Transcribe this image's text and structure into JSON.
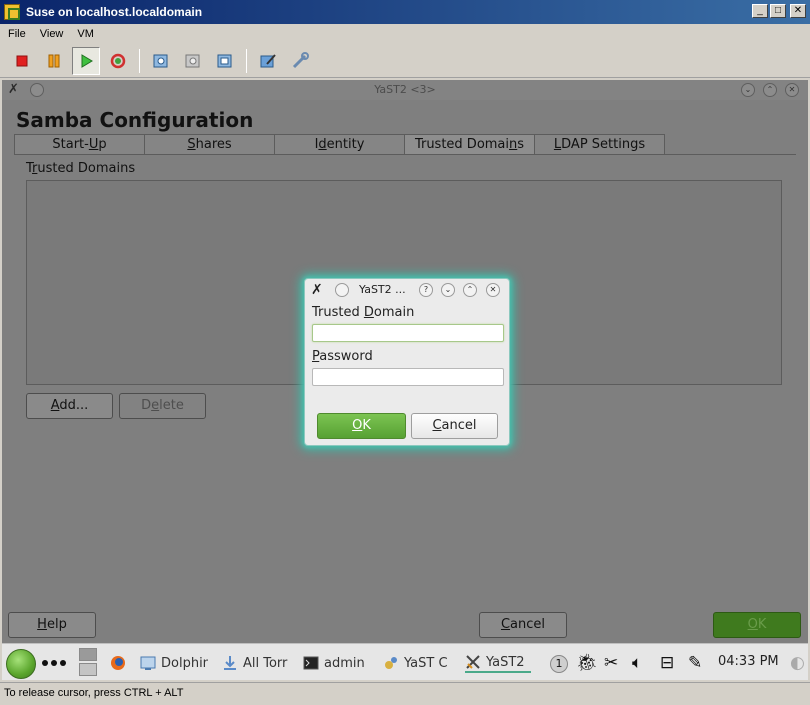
{
  "host": {
    "title": "Suse on localhost.localdomain",
    "menu": [
      "File",
      "View",
      "VM"
    ],
    "toolbar": [
      "stop-icon",
      "pause-icon",
      "play-icon",
      "reset-icon",
      "snapshot-icon",
      "revert-snapshot-icon",
      "manage-snapshots-icon",
      "edit-settings-icon",
      "vm-tools-icon"
    ],
    "status_text": "To release cursor, press CTRL + ALT"
  },
  "guest": {
    "window_title": "YaST2 <3>",
    "app_heading": "Samba Configuration",
    "tabs": [
      {
        "label": "Start-Up",
        "mnemonic": "U"
      },
      {
        "label": "Shares",
        "mnemonic": "S"
      },
      {
        "label": "Identity",
        "mnemonic": "d"
      },
      {
        "label": "Trusted Domains",
        "mnemonic": "n",
        "active": true
      },
      {
        "label": "LDAP Settings",
        "mnemonic": "L"
      }
    ],
    "section_label": "Trusted Domains",
    "add_button": "Add...",
    "delete_button": "Delete",
    "help_button": "Help",
    "cancel_button": "Cancel",
    "ok_button": "OK"
  },
  "dialog": {
    "title": "YaST2 ...",
    "domain_label": "Trusted Domain",
    "domain_value": "",
    "password_label": "Password",
    "password_value": "",
    "ok_label": "OK",
    "cancel_label": "Cancel"
  },
  "taskbar": {
    "tasks": [
      {
        "label": "Dolphin"
      },
      {
        "label": "All Torr"
      },
      {
        "label": "admin"
      },
      {
        "label": "YaST C"
      },
      {
        "label": "YaST2",
        "active": true
      }
    ],
    "desktop_number": "1",
    "clock": "04:33 PM"
  }
}
